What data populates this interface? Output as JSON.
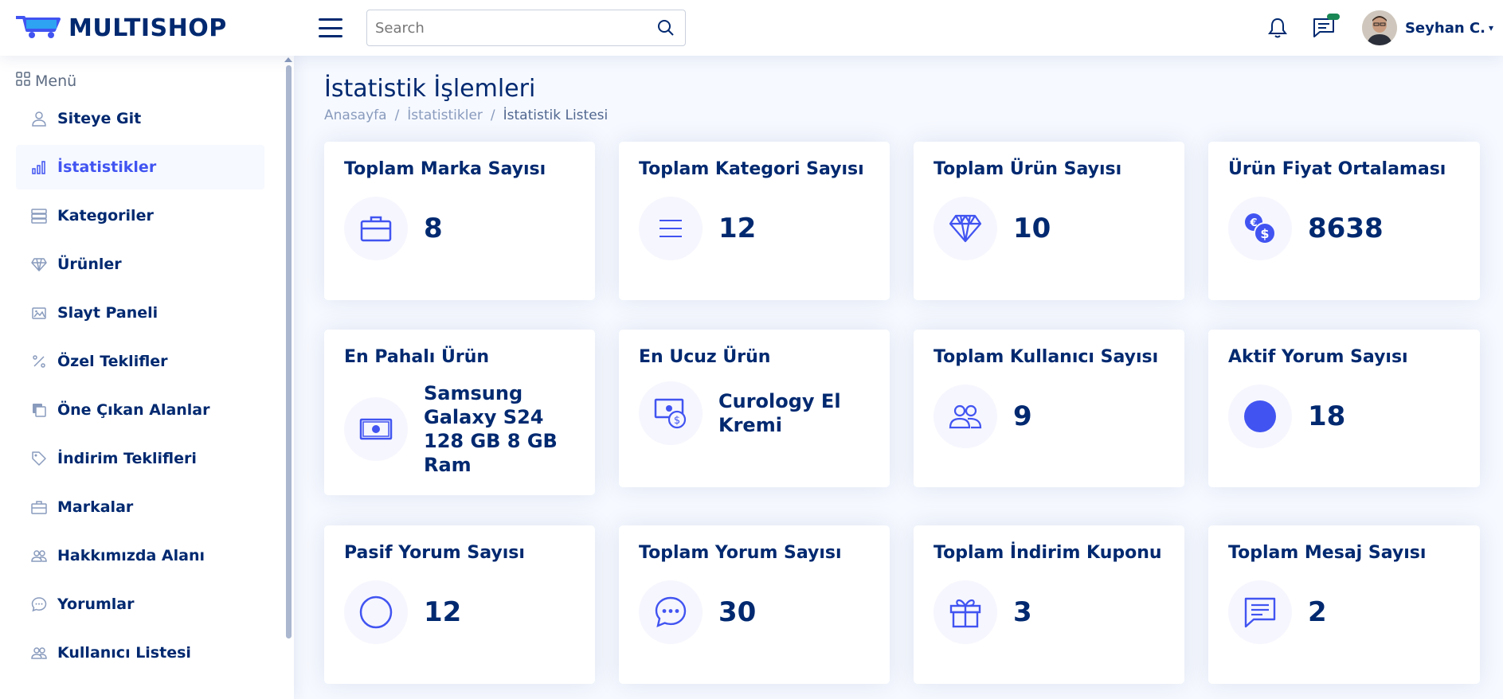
{
  "header": {
    "logo_text": "MULTISHOP",
    "search_placeholder": "Search",
    "user_name": "Seyhan C.",
    "message_badge_color": "#198754"
  },
  "sidebar": {
    "heading": "Menü",
    "items": [
      {
        "label": "Siteye Git",
        "icon": "person-icon"
      },
      {
        "label": "İstatistikler",
        "icon": "bar-chart-icon",
        "active": true
      },
      {
        "label": "Kategoriler",
        "icon": "server-icon"
      },
      {
        "label": "Ürünler",
        "icon": "gem-icon"
      },
      {
        "label": "Slayt Paneli",
        "icon": "images-icon"
      },
      {
        "label": "Özel Teklifler",
        "icon": "percent-icon"
      },
      {
        "label": "Öne Çıkan Alanlar",
        "icon": "layers-icon"
      },
      {
        "label": "İndirim Teklifleri",
        "icon": "tag-icon"
      },
      {
        "label": "Markalar",
        "icon": "briefcase-icon"
      },
      {
        "label": "Hakkımızda Alanı",
        "icon": "people-icon"
      },
      {
        "label": "Yorumlar",
        "icon": "chat-dots-icon"
      },
      {
        "label": "Kullanıcı Listesi",
        "icon": "people-icon"
      }
    ]
  },
  "main": {
    "title": "İstatistik İşlemleri",
    "breadcrumb": [
      "Anasayfa",
      "İstatistikler",
      "İstatistik Listesi"
    ],
    "cards": [
      {
        "title": "Toplam Marka Sayısı",
        "value": "8",
        "icon": "briefcase-icon"
      },
      {
        "title": "Toplam Kategori Sayısı",
        "value": "12",
        "icon": "list-icon"
      },
      {
        "title": "Toplam Ürün Sayısı",
        "value": "10",
        "icon": "gem-icon"
      },
      {
        "title": "Ürün Fiyat Ortalaması",
        "value": "8638",
        "icon": "currency-exchange-icon"
      },
      {
        "title": "En Pahalı Ürün",
        "value": "Samsung Galaxy S24 128 GB 8 GB Ram",
        "icon": "cash-icon"
      },
      {
        "title": "En Ucuz Ürün",
        "value": "Curology El Kremi",
        "icon": "cash-coin-icon"
      },
      {
        "title": "Toplam Kullanıcı Sayısı",
        "value": "9",
        "icon": "people-icon"
      },
      {
        "title": "Aktif Yorum Sayısı",
        "value": "18",
        "icon": "circle-fill-icon"
      },
      {
        "title": "Pasif Yorum Sayısı",
        "value": "12",
        "icon": "circle-icon"
      },
      {
        "title": "Toplam Yorum Sayısı",
        "value": "30",
        "icon": "chat-dots-icon"
      },
      {
        "title": "Toplam İndirim Kuponu",
        "value": "3",
        "icon": "gift-icon"
      },
      {
        "title": "Toplam Mesaj Sayısı",
        "value": "2",
        "icon": "chat-left-text-icon"
      }
    ]
  }
}
